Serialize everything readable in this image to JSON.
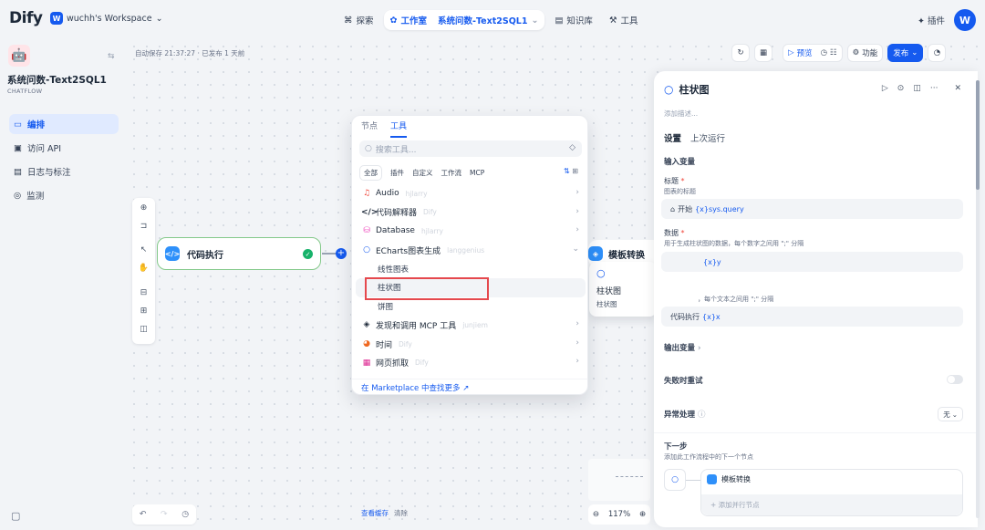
{
  "topbar": {
    "logo": "Dify",
    "workspace_badge": "W",
    "workspace": "wuchh's Workspace",
    "nav": {
      "explore": "探索",
      "studio": "工作室",
      "app_crumb": "系统问数-Text2SQL1",
      "knowledge": "知识库",
      "tools": "工具"
    },
    "plugins": "插件",
    "avatar": "W"
  },
  "sidebar": {
    "app_name": "系统问数-Text2SQL1",
    "app_type": "CHATFLOW",
    "items": [
      {
        "label": "编排",
        "icon": "layout-icon",
        "active": true
      },
      {
        "label": "访问 API",
        "icon": "terminal-icon",
        "active": false
      },
      {
        "label": "日志与标注",
        "icon": "file-list-icon",
        "active": false
      },
      {
        "label": "监测",
        "icon": "monitor-icon",
        "active": false
      }
    ]
  },
  "canvas": {
    "autosave": "自动保存 21:37:27 · 已发布 1 天前",
    "toolbar": {
      "preview": "预览",
      "features": "功能",
      "publish": "发布"
    },
    "node_code": "代码执行",
    "node_template": "模板转换",
    "hover_card": {
      "title": "柱状图",
      "subtitle": "柱状图"
    },
    "cache_view": "查看缓存",
    "cache_clear": "清除",
    "zoom": "117%"
  },
  "picker": {
    "tabs": [
      "节点",
      "工具"
    ],
    "search_placeholder": "搜索工具...",
    "filters": [
      "全部",
      "插件",
      "自定义",
      "工作流",
      "MCP"
    ],
    "rows": [
      {
        "label": "Audio",
        "author": "hjlarry",
        "icon": "audio-icon",
        "chevron": "›"
      },
      {
        "label": "代码解释器",
        "author": "Dify",
        "icon": "code-icon",
        "chevron": "›"
      },
      {
        "label": "Database",
        "author": "hjlarry",
        "icon": "database-icon",
        "chevron": "›"
      },
      {
        "label": "ECharts图表生成",
        "author": "langgenius",
        "icon": "chart-icon",
        "chevron": "⌄"
      },
      {
        "label": "线性图表",
        "sub": true
      },
      {
        "label": "柱状图",
        "sub": true,
        "selected": true
      },
      {
        "label": "饼图",
        "sub": true
      },
      {
        "label": "发现和调用 MCP 工具",
        "author": "junjiem",
        "icon": "mcp-icon",
        "chevron": "›"
      },
      {
        "label": "时间",
        "author": "Dify",
        "icon": "clock-icon",
        "chevron": "›"
      },
      {
        "label": "网页抓取",
        "author": "Dify",
        "icon": "web-icon",
        "chevron": "›"
      }
    ],
    "marketplace": "在 Marketplace 中查找更多 ↗"
  },
  "panel": {
    "title": "柱状图",
    "desc_placeholder": "添加描述...",
    "tabs": [
      "设置",
      "上次运行"
    ],
    "input_vars": "输入变量",
    "title_label": "标题",
    "title_hint": "图表的标题",
    "title_value_node": "开始",
    "title_value_var": "{x}sys.query",
    "data_label": "数据",
    "data_hint": "用于生成柱状图的数据，每个数字之间用 \";\" 分隔",
    "data_value_var": "{x}y",
    "x_hint": "，每个文本之间用 \";\" 分隔",
    "x_value_node": "代码执行",
    "x_value_var": "{x}x",
    "output_vars": "输出变量",
    "retry": "失败时重试",
    "exception": "异常处理",
    "exception_value": "无",
    "next_step": "下一步",
    "next_hint": "添加此工作流程中的下一个节点",
    "next_node": "模板转换",
    "add_parallel": "+ 添加并行节点"
  },
  "colors": {
    "primary": "#155aef",
    "success": "#17b26a",
    "highlight": "#e5484d"
  }
}
